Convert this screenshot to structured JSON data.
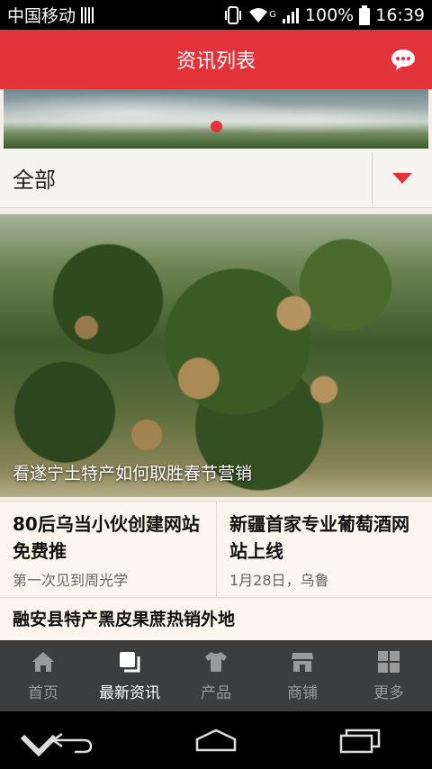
{
  "status": {
    "carrier": "中国移动",
    "battery": "100%",
    "time": "16:39",
    "net": "G"
  },
  "header": {
    "title": "资讯列表"
  },
  "filter": {
    "selected": "全部"
  },
  "feature": {
    "caption": "看遂宁土特产如何取胜春节营销"
  },
  "news_grid": [
    {
      "title": "80后乌当小伙创建网站 免费推",
      "sub": "第一次见到周光学"
    },
    {
      "title": "新疆首家专业葡萄酒网站上线",
      "sub": "1月28日，乌鲁"
    }
  ],
  "news_single": {
    "title": "融安县特产黑皮果蔗热销外地"
  },
  "tabs": [
    {
      "label": "首页",
      "icon": "home-icon"
    },
    {
      "label": "最新资讯",
      "icon": "news-icon"
    },
    {
      "label": "产品",
      "icon": "shirt-icon"
    },
    {
      "label": "商铺",
      "icon": "store-icon"
    },
    {
      "label": "更多",
      "icon": "grid-icon"
    }
  ],
  "colors": {
    "brand": "#e2333a",
    "tabbar": "#3c3d3f"
  }
}
